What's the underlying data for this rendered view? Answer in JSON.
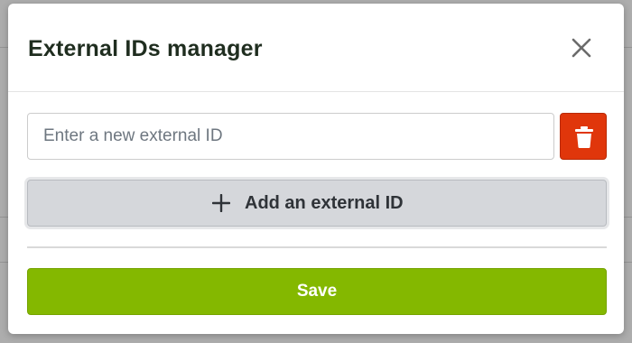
{
  "modal": {
    "title": "External IDs manager",
    "input_placeholder": "Enter a new external ID",
    "input_value": "",
    "add_button_label": "Add an external ID",
    "save_button_label": "Save"
  },
  "icons": {
    "close": "close-icon",
    "delete": "trash-icon",
    "add": "plus-icon"
  },
  "colors": {
    "delete_button": "#e0360b",
    "save_button": "#84b800",
    "add_button": "#d5d7db",
    "title_text": "#1f2d1f"
  }
}
